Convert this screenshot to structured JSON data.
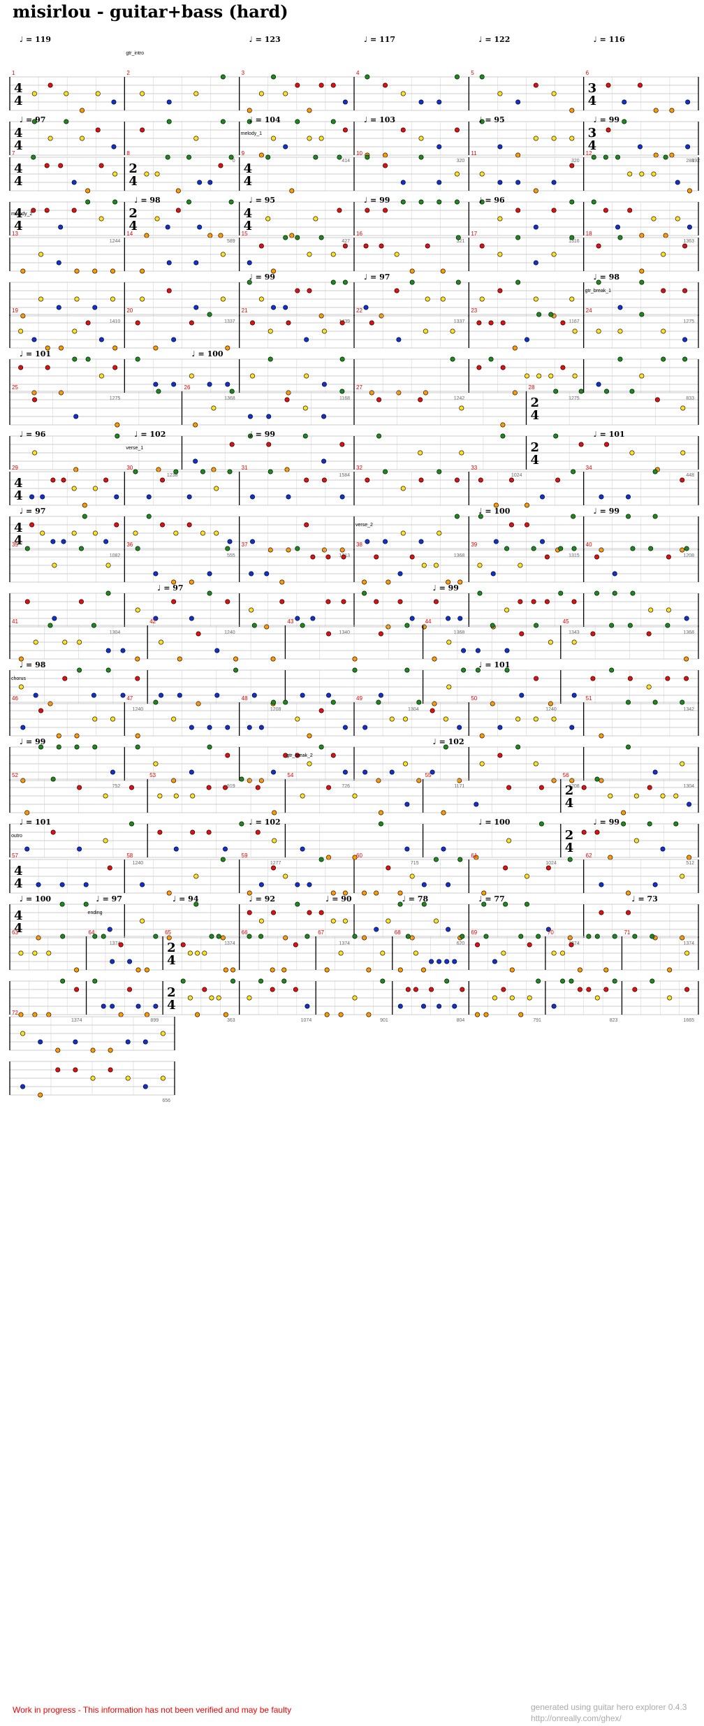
{
  "title": "misirlou - guitar+bass (hard)",
  "colors": {
    "green": "#1a8a1a",
    "red": "#e01010",
    "yellow": "#ffe020",
    "blue": "#1030d0",
    "orange": "#ff9900",
    "measure_num": "#e00000",
    "staff": "#999999"
  },
  "rows": [
    {
      "tempos": [
        {
          "m": 1,
          "bpm": "119"
        },
        {
          "m": 3,
          "bpm": "123"
        },
        {
          "m": 4,
          "bpm": "117"
        },
        {
          "m": 5,
          "bpm": "122"
        },
        {
          "m": 6,
          "bpm": "116"
        }
      ],
      "sections": [
        {
          "m": 2,
          "label": "gtr_intro"
        }
      ],
      "measures": [
        {
          "n": "1",
          "ts": "4/4",
          "count": ""
        },
        {
          "n": "2",
          "count": "0"
        },
        {
          "n": "3",
          "count": "414"
        },
        {
          "n": "4",
          "count": "320"
        },
        {
          "n": "5",
          "count": "320"
        },
        {
          "n": "6",
          "ts": "3/4",
          "count": "288"
        }
      ],
      "trailing_count": "192"
    },
    {
      "tempos": [
        {
          "m": 7,
          "bpm": "97"
        },
        {
          "m": 9,
          "bpm": "104"
        },
        {
          "m": 10,
          "bpm": "103"
        },
        {
          "m": 11,
          "bpm": "95"
        },
        {
          "m": 12,
          "bpm": "99"
        }
      ],
      "sections": [
        {
          "m": 9,
          "label": "melody_1"
        }
      ],
      "measures": [
        {
          "n": "7",
          "ts": "4/4",
          "count": "1244"
        },
        {
          "n": "8",
          "ts": "2/4",
          "count": "589"
        },
        {
          "n": "9",
          "ts": "4/4",
          "count": "427"
        },
        {
          "n": "10",
          "count": "321"
        },
        {
          "n": "11",
          "count": "1316"
        },
        {
          "n": "12",
          "count": "1363"
        }
      ],
      "trailing_count": ""
    },
    {
      "tempos": [
        {
          "m": 14,
          "bpm": "98"
        },
        {
          "m": 15,
          "bpm": "95"
        },
        {
          "m": 16,
          "bpm": "99"
        },
        {
          "m": 17,
          "bpm": "96"
        }
      ],
      "sections": [
        {
          "m": 13,
          "label": "melody_2"
        }
      ],
      "measures": [
        {
          "n": "13",
          "count": "1410"
        },
        {
          "n": "14",
          "count": "1337"
        },
        {
          "n": "15",
          "count": "1439"
        },
        {
          "n": "16",
          "count": "1337"
        },
        {
          "n": "17",
          "count": "1167"
        },
        {
          "n": "18",
          "count": "1275"
        }
      ],
      "trailing_count": ""
    },
    {
      "tempos": [
        {
          "m": 21,
          "bpm": "99"
        },
        {
          "m": 22,
          "bpm": "97"
        },
        {
          "m": 24,
          "bpm": "98"
        }
      ],
      "sections": [
        {
          "m": 24,
          "label": "gtr_break_1"
        }
      ],
      "measures": [
        {
          "n": "19",
          "count": "1275"
        },
        {
          "n": "20",
          "count": "1368"
        },
        {
          "n": "21",
          "count": "1168"
        },
        {
          "n": "22",
          "count": "1242"
        },
        {
          "n": "23",
          "count": "1275"
        },
        {
          "n": "24",
          "count": "833"
        }
      ],
      "trailing_count": ""
    },
    {
      "tempos": [
        {
          "m": 25,
          "bpm": "101"
        },
        {
          "m": 26,
          "bpm": "100"
        }
      ],
      "sections": [],
      "measures": [
        {
          "n": "25",
          "count": "1238"
        },
        {
          "n": "26",
          "count": "1584"
        },
        {
          "n": "27",
          "count": "1024"
        },
        {
          "n": "28",
          "ts": "2/4",
          "count": "448"
        }
      ],
      "trailing_count": ""
    },
    {
      "tempos": [
        {
          "m": 29,
          "bpm": "96"
        },
        {
          "m": 30,
          "bpm": "102"
        },
        {
          "m": 31,
          "bpm": "99"
        },
        {
          "m": 34,
          "bpm": "101"
        }
      ],
      "sections": [
        {
          "m": 30,
          "label": "verse_1"
        }
      ],
      "measures": [
        {
          "n": "29",
          "ts": "4/4",
          "count": "1082"
        },
        {
          "n": "30",
          "count": "555"
        },
        {
          "n": "31",
          "count": "1313"
        },
        {
          "n": "32",
          "count": "1368"
        },
        {
          "n": "33",
          "count": "1315"
        },
        {
          "n": "34",
          "count": "1208"
        }
      ],
      "trailing_count": ""
    },
    {
      "tempos": [
        {
          "m": 35,
          "bpm": "97"
        },
        {
          "m": 39,
          "bpm": "100"
        },
        {
          "m": 40,
          "bpm": "99"
        }
      ],
      "sections": [
        {
          "m": 38,
          "label": "verse_2"
        }
      ],
      "measures": [
        {
          "n": "35",
          "count": "1304"
        },
        {
          "n": "36",
          "count": "1240"
        },
        {
          "n": "37",
          "count": "1340"
        },
        {
          "n": "38",
          "count": "1368"
        },
        {
          "n": "39",
          "count": "1343"
        },
        {
          "n": "40",
          "count": "1368"
        }
      ],
      "trailing_count": ""
    },
    {
      "tempos": [
        {
          "m": 42,
          "bpm": "97"
        },
        {
          "m": 44,
          "bpm": "99"
        }
      ],
      "sections": [],
      "measures": [
        {
          "n": "41",
          "count": "1240"
        },
        {
          "n": "42",
          "count": "1208"
        },
        {
          "n": "43",
          "count": "1304"
        },
        {
          "n": "44",
          "count": "1240"
        },
        {
          "n": "45",
          "count": "1342"
        }
      ],
      "trailing_count": ""
    },
    {
      "tempos": [
        {
          "m": 46,
          "bpm": "98"
        },
        {
          "m": 50,
          "bpm": "101"
        }
      ],
      "sections": [
        {
          "m": 46,
          "label": "chorus"
        }
      ],
      "measures": [
        {
          "n": "46",
          "count": "752"
        },
        {
          "n": "47",
          "count": "919"
        },
        {
          "n": "48",
          "count": "726"
        },
        {
          "n": "49",
          "count": "1171"
        },
        {
          "n": "50",
          "count": "1208"
        },
        {
          "n": "51",
          "count": "1304"
        }
      ],
      "trailing_count": ""
    },
    {
      "tempos": [
        {
          "m": 52,
          "bpm": "99"
        },
        {
          "m": 55,
          "bpm": "102"
        }
      ],
      "sections": [
        {
          "m": 54,
          "label": "gtr_break_2"
        }
      ],
      "measures": [
        {
          "n": "52",
          "count": "1240"
        },
        {
          "n": "53",
          "count": "1277"
        },
        {
          "n": "54",
          "count": "715"
        },
        {
          "n": "55",
          "count": "1024"
        },
        {
          "n": "56",
          "ts": "2/4",
          "count": "512"
        }
      ],
      "trailing_count": ""
    },
    {
      "tempos": [
        {
          "m": 57,
          "bpm": "101"
        },
        {
          "m": 59,
          "bpm": "102"
        },
        {
          "m": 61,
          "bpm": "100"
        },
        {
          "m": 62,
          "bpm": "99"
        }
      ],
      "sections": [
        {
          "m": 57,
          "label": "outro"
        }
      ],
      "measures": [
        {
          "n": "57",
          "ts": "4/4",
          "count": "1374"
        },
        {
          "n": "58",
          "count": "1374"
        },
        {
          "n": "59",
          "count": "1374"
        },
        {
          "n": "60",
          "count": "620"
        },
        {
          "n": "61",
          "count": "1374"
        },
        {
          "n": "62",
          "count": "1374"
        }
      ],
      "trailing_count": ""
    },
    {
      "tempos": [
        {
          "m": 63,
          "bpm": "100"
        },
        {
          "m": 64,
          "bpm": "97"
        },
        {
          "m": 65,
          "bpm": "94"
        },
        {
          "m": 66,
          "bpm": "92"
        },
        {
          "m": 67,
          "bpm": "90"
        },
        {
          "m": 68,
          "bpm": "78"
        },
        {
          "m": 69,
          "bpm": "77"
        },
        {
          "m": 71,
          "bpm": "73"
        }
      ],
      "sections": [
        {
          "m": 64,
          "label": "ending"
        }
      ],
      "measures": [
        {
          "n": "63",
          "count": "1374"
        },
        {
          "n": "64",
          "count": "899"
        },
        {
          "n": "65",
          "ts": "2/4",
          "count": "363"
        },
        {
          "n": "66",
          "count": "1074"
        },
        {
          "n": "67",
          "count": "901"
        },
        {
          "n": "68",
          "count": "804"
        },
        {
          "n": "69",
          "count": "791"
        },
        {
          "n": "70",
          "count": "823"
        },
        {
          "n": "71",
          "count": "1665"
        }
      ],
      "trailing_count": ""
    },
    {
      "tempos": [],
      "sections": [],
      "measures": [
        {
          "n": "72",
          "count": "656"
        }
      ],
      "trailing_count": ""
    }
  ],
  "footer": {
    "wip": "Work in progress - This information has not been verified and may be faulty",
    "generated": "generated using guitar hero explorer 0.4.3",
    "url": "http://onreally.com/ghex/"
  }
}
